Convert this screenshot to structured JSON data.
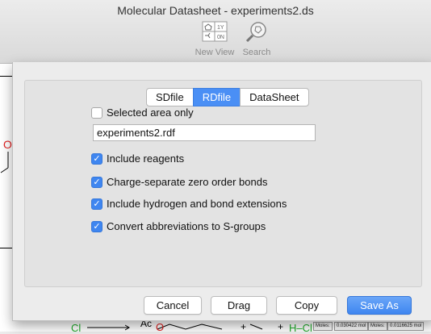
{
  "window": {
    "title": "Molecular Datasheet - experiments2.ds"
  },
  "toolbar": {
    "new_view": {
      "label": "New View",
      "icon": "new-view-icon"
    },
    "search": {
      "label": "Search",
      "icon": "search-icon"
    }
  },
  "background": {
    "atoms": {
      "oxygen1": "O",
      "oxygen2": "O",
      "chlorine": "Cl",
      "chlorine2": "H–Cl",
      "ac": "Ac"
    },
    "moles_labels": [
      "Moles:",
      "0.030422 mol",
      "Moles:",
      "0.0116625 mol"
    ]
  },
  "dialog": {
    "tabs": [
      {
        "label": "SDfile",
        "active": false
      },
      {
        "label": "RDfile",
        "active": true
      },
      {
        "label": "DataSheet",
        "active": false
      }
    ],
    "options": {
      "selected_area_only": {
        "label": "Selected area only",
        "checked": false
      },
      "filename": "experiments2.rdf",
      "include_reagents": {
        "label": "Include reagents",
        "checked": true
      },
      "charge_separate": {
        "label": "Charge-separate zero order bonds",
        "checked": true
      },
      "include_hydrogen": {
        "label": "Include hydrogen and bond extensions",
        "checked": true
      },
      "convert_abbrev": {
        "label": "Convert abbreviations to S-groups",
        "checked": true
      }
    },
    "buttons": {
      "cancel": "Cancel",
      "drag": "Drag",
      "copy": "Copy",
      "save_as": "Save As"
    }
  },
  "colors": {
    "accent": "#3f86f0",
    "oxygen": "#e02020",
    "chlorine": "#1fae2a"
  }
}
